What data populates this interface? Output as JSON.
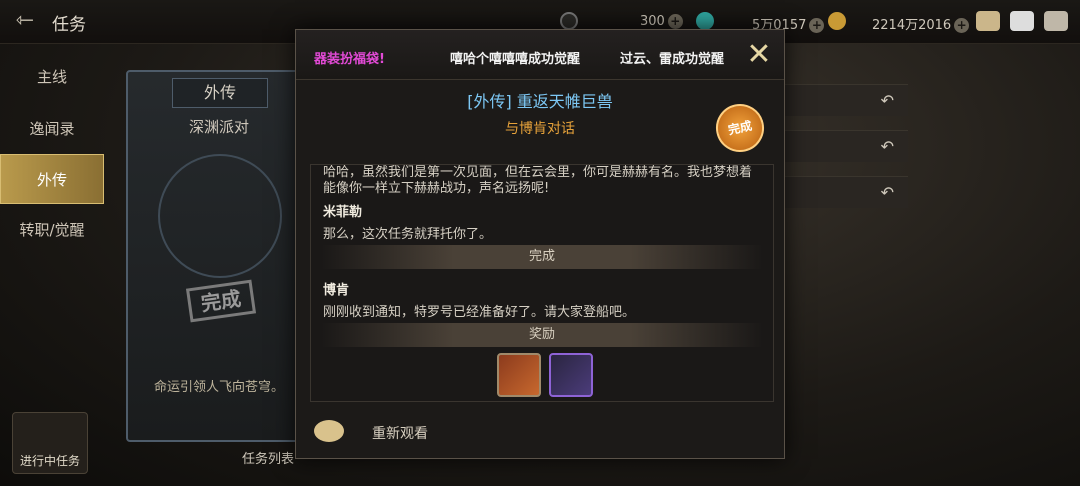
{
  "header": {
    "back_icon": "back-arrow-icon",
    "title": "任务",
    "resources": [
      {
        "icon": "gem-icon",
        "value": "300"
      },
      {
        "icon": "gold-icon",
        "value": "5万0157"
      },
      {
        "icon": "coin-icon",
        "value": "2214万2016"
      }
    ],
    "buttons": [
      "bag-icon",
      "mail-icon",
      "chat-icon"
    ]
  },
  "sidebar": {
    "items": [
      {
        "label": "主线",
        "active": false
      },
      {
        "label": "逸闻录",
        "active": false
      },
      {
        "label": "外传",
        "active": true
      },
      {
        "label": "转职/觉醒",
        "active": false
      }
    ]
  },
  "card": {
    "header": "外传",
    "subtitle": "深渊派对",
    "stamp": "完成",
    "footer": "命运引领人飞向苍穹。"
  },
  "list_button": "任务列表",
  "active_task_label": "进行中任务",
  "modal": {
    "ticker": [
      {
        "text": "器装扮福袋!",
        "color": "#e24ad6"
      },
      {
        "text": "嘻哈个嘻嘻嘻成功觉醒",
        "color": "#f2f2f2"
      },
      {
        "text": "过云、雷成功觉醒",
        "color": "#f2f2f2"
      }
    ],
    "title": "[外传] 重返天帷巨兽",
    "subtitle": "与博肯对话",
    "badge": "完成",
    "dialogue": {
      "line1": "哈哈，虽然我们是第一次见面，但在云会里，你可是赫赫有名。我也梦想着",
      "line2": "能像你一样立下赫赫战功，声名远扬呢!",
      "speaker1": "米菲勒",
      "line3": "那么，这次任务就拜托你了。",
      "divider1": "完成",
      "speaker2": "博肯",
      "line4": "刚刚收到通知，特罗号已经准备好了。请大家登船吧。",
      "divider2": "奖励"
    },
    "rewards": [
      "reward-box-icon",
      "reward-accessory-icon"
    ],
    "replay_label": "重新观看"
  }
}
